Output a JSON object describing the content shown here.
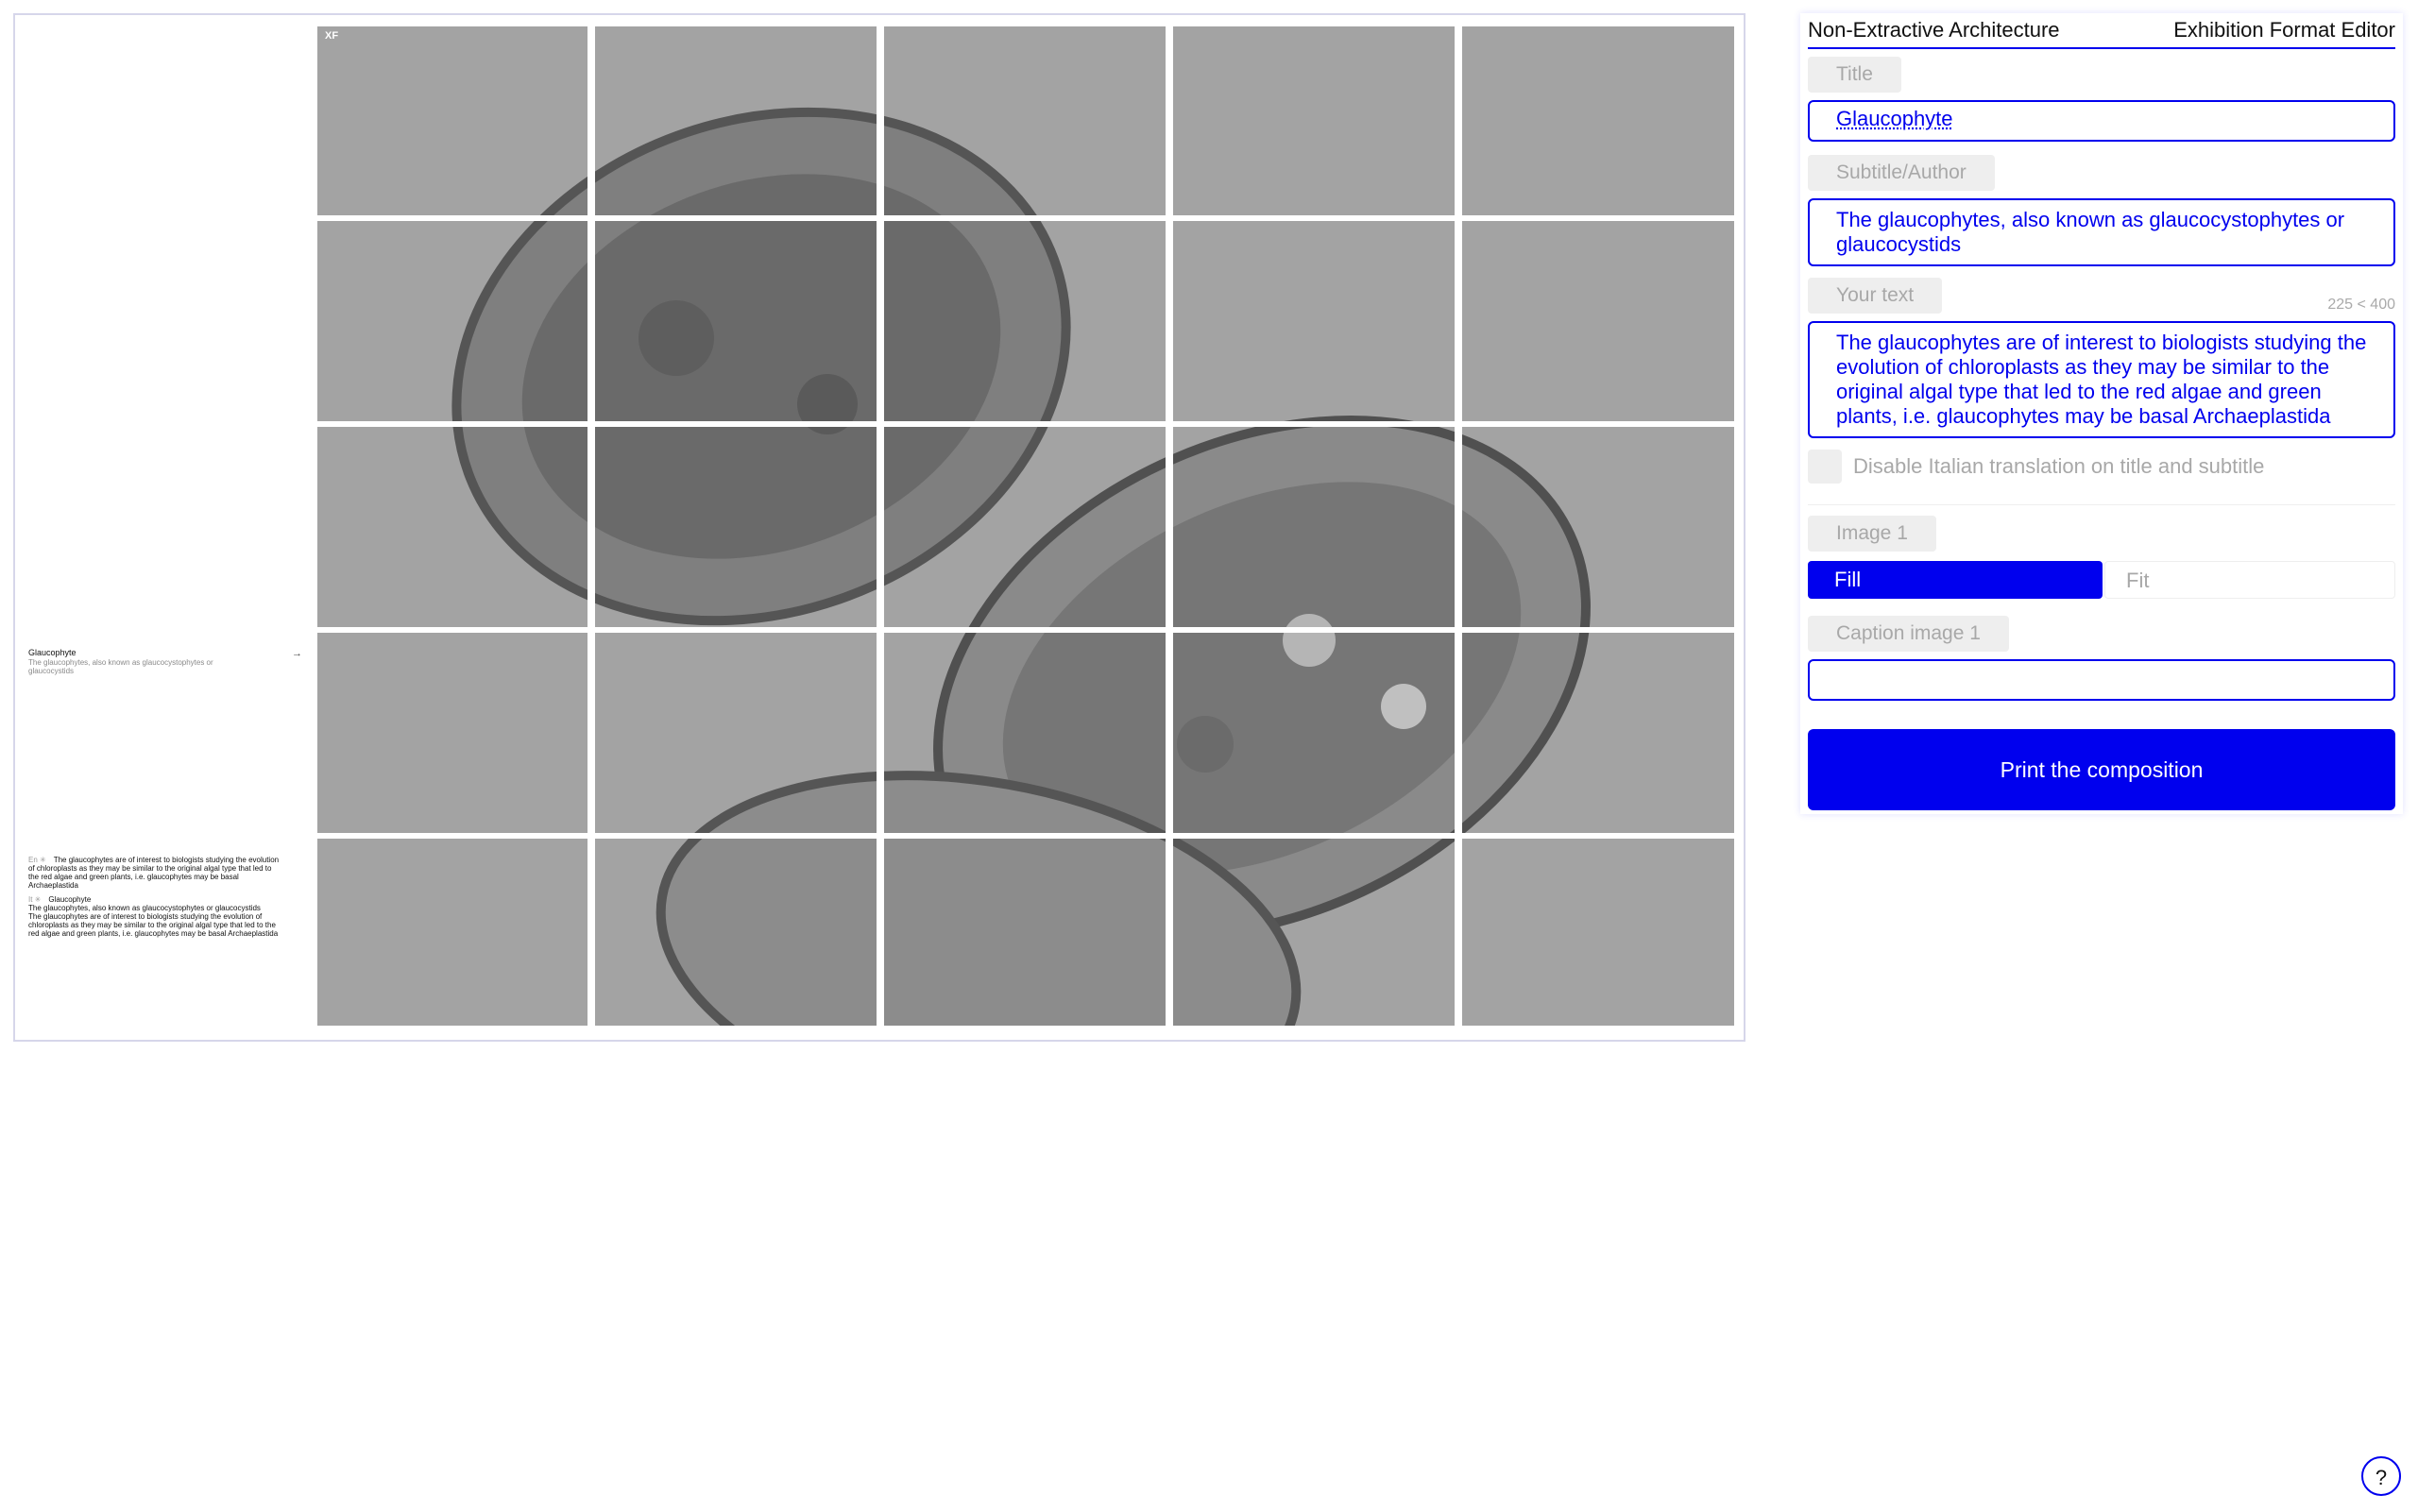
{
  "preview": {
    "mark": "XF",
    "caption": {
      "title": "Glaucophyte",
      "subtitle": "The glaucophytes, also known as glaucocystophytes or glaucocystids",
      "arrow": "→"
    },
    "body": {
      "en_tag": "En ✳",
      "en_text": "The glaucophytes are of interest to biologists studying the evolution of chloroplasts as they may be similar to the original algal type that led to the red algae and green plants, i.e. glaucophytes may be basal Archaeplastida",
      "it_tag": "It ✳",
      "it_title": "Glaucophyte",
      "it_subtitle": "The glaucophytes, also known as glaucocystophytes or glaucocystids",
      "it_text": "The glaucophytes are of interest to biologists studying the evolution of chloroplasts as they may be similar to the original algal type that led to the red algae and green plants, i.e. glaucophytes may be basal Archaeplastida"
    }
  },
  "editor": {
    "app_name": "Non-Extractive Architecture",
    "editor_name": "Exhibition Format Editor",
    "title_label": "Title",
    "title_value": "Glaucophyte",
    "subtitle_label": "Subtitle/Author",
    "subtitle_value": "The glaucophytes, also known as glaucocystophytes or glaucocystids",
    "text_label": "Your text",
    "char_counter": "225 < 400",
    "text_value": "The glaucophytes are of interest to biologists studying the evolution of chloroplasts as they may be similar to the original algal type that led to the red algae and green plants, i.e. glaucophytes may be basal Archaeplastida",
    "translation_toggle_label": "Disable Italian translation on title and subtitle",
    "translation_disabled": false,
    "image_label": "Image 1",
    "fill_label": "Fill",
    "fit_label": "Fit",
    "selected_mode": "Fill",
    "caption_label": "Caption image 1",
    "caption_value": "",
    "print_label": "Print the composition",
    "help_label": "?"
  },
  "colors": {
    "accent": "#0000ee",
    "chip_bg": "#eeeeee",
    "muted_text": "#a8a8a8"
  }
}
